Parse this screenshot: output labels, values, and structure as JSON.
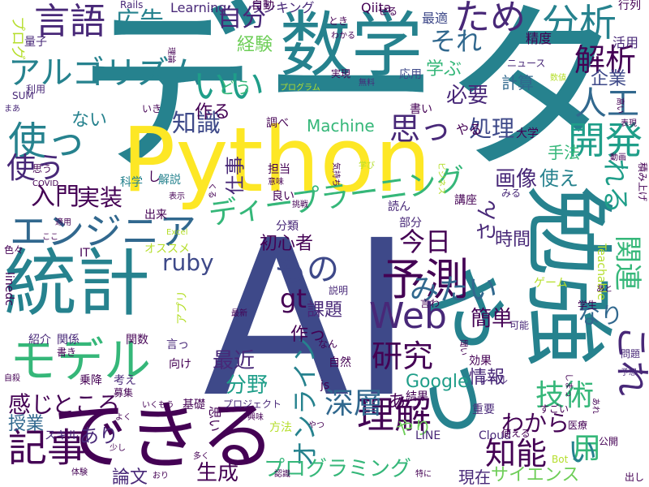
{
  "palette": {
    "yellow": "#fde725",
    "light_green": "#b5de2b",
    "green": "#6ece58",
    "green_teal": "#35b779",
    "teal": "#1f9e89",
    "blue_teal": "#26828e",
    "blue": "#31688e",
    "indigo": "#3e4989",
    "purple": "#482878",
    "dark_purple": "#440154"
  },
  "words": [
    {
      "text": "データ",
      "color": "#26828e",
      "rot": 0
    },
    {
      "text": "AI",
      "color": "#3e4989",
      "rot": 0
    },
    {
      "text": "Python",
      "color": "#fde725",
      "rot": 0
    },
    {
      "text": "数学",
      "color": "#26828e",
      "rot": 0
    },
    {
      "text": "勉強",
      "color": "#26828e",
      "rot": 90
    },
    {
      "text": "できる",
      "color": "#440154",
      "rot": 0
    },
    {
      "text": "統計",
      "color": "#26828e",
      "rot": 0
    },
    {
      "text": "やっ",
      "color": "#26828e",
      "rot": 90
    },
    {
      "text": "モデル",
      "color": "#35b779",
      "rot": 0
    },
    {
      "text": "言語",
      "color": "#482878",
      "rot": 0
    },
    {
      "text": "アルゴリズム",
      "color": "#26828e",
      "rot": 0
    },
    {
      "text": "使っ",
      "color": "#26828e",
      "rot": 0
    },
    {
      "text": "エンジニア",
      "color": "#31688e",
      "rot": 0
    },
    {
      "text": "ディープラーニング",
      "color": "#35b779",
      "rot": 0
    },
    {
      "text": "予測",
      "color": "#440154",
      "rot": 0
    },
    {
      "text": "分析",
      "color": "#26828e",
      "rot": 0
    },
    {
      "text": "ため",
      "color": "#482878",
      "rot": 0
    },
    {
      "text": "開発",
      "color": "#1f9e89",
      "rot": 0
    },
    {
      "text": "人工",
      "color": "#31688e",
      "rot": 0
    },
    {
      "text": "解析",
      "color": "#440154",
      "rot": 0
    },
    {
      "text": "自分",
      "color": "#482878",
      "rot": 0
    },
    {
      "text": "いい",
      "color": "#1f9e89",
      "rot": 0
    },
    {
      "text": "Web",
      "color": "#482878",
      "rot": 0
    },
    {
      "text": "理解",
      "color": "#440154",
      "rot": 0
    },
    {
      "text": "記事",
      "color": "#440154",
      "rot": 0
    },
    {
      "text": "研究",
      "color": "#440154",
      "rot": 0
    },
    {
      "text": "技術",
      "color": "#35b779",
      "rot": 0
    },
    {
      "text": "知能",
      "color": "#440154",
      "rot": 0
    },
    {
      "text": "深層",
      "color": "#31688e",
      "rot": 0
    },
    {
      "text": "もの",
      "color": "#3e4989",
      "rot": 0
    },
    {
      "text": "入門",
      "color": "#440154",
      "rot": 0
    },
    {
      "text": "これ",
      "color": "#482878",
      "rot": 90
    },
    {
      "text": "使う",
      "color": "#482878",
      "rot": 0
    },
    {
      "text": "オンライン",
      "color": "#26828e",
      "rot": 270
    },
    {
      "text": "プログラミング",
      "color": "#35b779",
      "rot": 0
    },
    {
      "text": "みたい",
      "color": "#31688e",
      "rot": 0
    },
    {
      "text": "今日",
      "color": "#440154",
      "rot": 0
    },
    {
      "text": "知識",
      "color": "#3e4989",
      "rot": 0
    },
    {
      "text": "関連",
      "color": "#35b779",
      "rot": 90
    },
    {
      "text": "用",
      "color": "#35b779",
      "rot": 0
    },
    {
      "text": "思っ",
      "color": "#482878",
      "rot": 0
    },
    {
      "text": "それ",
      "color": "#31688e",
      "rot": 0
    },
    {
      "text": "企業",
      "color": "#3e4989",
      "rot": 0
    },
    {
      "text": "ruby",
      "color": "#3e4989",
      "rot": 0
    },
    {
      "text": "gt",
      "color": "#440154",
      "rot": 0
    },
    {
      "text": "初心者",
      "color": "#440154",
      "rot": 0
    },
    {
      "text": "広告",
      "color": "#26828e",
      "rot": 0
    },
    {
      "text": "処理",
      "color": "#3e4989",
      "rot": 0
    },
    {
      "text": "画像",
      "color": "#482878",
      "rot": 0
    },
    {
      "text": "使え",
      "color": "#26828e",
      "rot": 0
    },
    {
      "text": "実装",
      "color": "#440154",
      "rot": 0
    },
    {
      "text": "仕事",
      "color": "#482878",
      "rot": 270
    },
    {
      "text": "Machine",
      "color": "#35b779",
      "rot": 0
    },
    {
      "text": "簡単",
      "color": "#440154",
      "rot": 0
    },
    {
      "text": "最近",
      "color": "#482878",
      "rot": 0
    },
    {
      "text": "分野",
      "color": "#1f9e89",
      "rot": 0
    },
    {
      "text": "感じ",
      "color": "#440154",
      "rot": 0
    },
    {
      "text": "ところ",
      "color": "#440154",
      "rot": 0
    },
    {
      "text": "わから",
      "color": "#440154",
      "rot": 0
    },
    {
      "text": "あり",
      "color": "#482878",
      "rot": 0
    },
    {
      "text": "授業",
      "color": "#31688e",
      "rot": 0
    },
    {
      "text": "論文",
      "color": "#482878",
      "rot": 0
    },
    {
      "text": "生成",
      "color": "#440154",
      "rot": 0
    },
    {
      "text": "Google",
      "color": "#1f9e89",
      "rot": 0
    },
    {
      "text": "情報",
      "color": "#482878",
      "rot": 0
    },
    {
      "text": "あっ",
      "color": "#440154",
      "rot": 0
    },
    {
      "text": "課題",
      "color": "#482878",
      "rot": 0
    },
    {
      "text": "作っ",
      "color": "#440154",
      "rot": 0
    },
    {
      "text": "時間",
      "color": "#482878",
      "rot": 0
    },
    {
      "text": "さん",
      "color": "#482878",
      "rot": 270
    },
    {
      "text": "れる",
      "color": "#1f9e89",
      "rot": 90
    },
    {
      "text": "経験",
      "color": "#6ece58",
      "rot": 0
    },
    {
      "text": "作る",
      "color": "#440154",
      "rot": 0
    },
    {
      "text": "必要",
      "color": "#482878",
      "rot": 0
    },
    {
      "text": "学ぶ",
      "color": "#35b779",
      "rot": 0
    },
    {
      "text": "計算",
      "color": "#31688e",
      "rot": 0
    },
    {
      "text": "手法",
      "color": "#35b779",
      "rot": 0
    },
    {
      "text": "なり",
      "color": "#31688e",
      "rot": 0
    },
    {
      "text": "い",
      "color": "#26828e",
      "rot": 0
    },
    {
      "text": "サイエンス",
      "color": "#6ece58",
      "rot": 0
    },
    {
      "text": "現在",
      "color": "#482878",
      "rot": 0
    },
    {
      "text": "やり",
      "color": "#6ece58",
      "rot": 0
    },
    {
      "text": "ランキング",
      "color": "#482878",
      "rot": 0
    },
    {
      "text": "ない",
      "color": "#26828e",
      "rot": 0
    },
    {
      "text": "どう",
      "color": "#35b779",
      "rot": 0
    },
    {
      "text": "自動",
      "color": "#440154",
      "rot": 0
    },
    {
      "text": "Qiita",
      "color": "#440154",
      "rot": 0
    },
    {
      "text": "ニュース",
      "color": "#482878",
      "rot": 0
    },
    {
      "text": "最適",
      "color": "#3e4989",
      "rot": 0
    },
    {
      "text": "精度",
      "color": "#440154",
      "rot": 0
    },
    {
      "text": "活用",
      "color": "#482878",
      "rot": 0
    },
    {
      "text": "行列",
      "color": "#440154",
      "rot": 0
    },
    {
      "text": "大学",
      "color": "#440154",
      "rot": 0
    },
    {
      "text": "Learning",
      "color": "#482878",
      "rot": 0
    },
    {
      "text": "Rails",
      "color": "#482878",
      "rot": 0
    },
    {
      "text": "量子",
      "color": "#482878",
      "rot": 0
    },
    {
      "text": "プログ",
      "color": "#b5de2b",
      "rot": 90
    },
    {
      "text": "SUM",
      "color": "#482878",
      "rot": 0
    },
    {
      "text": "利用",
      "color": "#482878",
      "rot": 0
    },
    {
      "text": "まあ",
      "color": "#482878",
      "rot": 0
    },
    {
      "text": "科学",
      "color": "#26828e",
      "rot": 0
    },
    {
      "text": "解説",
      "color": "#26828e",
      "rot": 0
    },
    {
      "text": "担当",
      "color": "#440154",
      "rot": 0
    },
    {
      "text": "良い",
      "color": "#440154",
      "rot": 0
    },
    {
      "text": "挑戦",
      "color": "#440154",
      "rot": 0
    },
    {
      "text": "読ん",
      "color": "#482878",
      "rot": 0
    },
    {
      "text": "講座",
      "color": "#440154",
      "rot": 0
    },
    {
      "text": "部分",
      "color": "#482878",
      "rot": 0
    },
    {
      "text": "分類",
      "color": "#482878",
      "rot": 0
    },
    {
      "text": "みる",
      "color": "#482878",
      "rot": 0
    },
    {
      "text": "積み上げ",
      "color": "#440154",
      "rot": 90
    },
    {
      "text": "出来",
      "color": "#440154",
      "rot": 0
    },
    {
      "text": "オススメ",
      "color": "#b5de2b",
      "rot": 0
    },
    {
      "text": "IT",
      "color": "#440154",
      "rot": 0
    },
    {
      "text": "Excel",
      "color": "#b5de2b",
      "rot": 0
    },
    {
      "text": "色々",
      "color": "#440154",
      "rot": 0
    },
    {
      "text": "COVID",
      "color": "#440154",
      "rot": 0
    },
    {
      "text": "linedc",
      "color": "#440154",
      "rot": 90
    },
    {
      "text": "アプリ",
      "color": "#b5de2b",
      "rot": 270
    },
    {
      "text": "紹介",
      "color": "#482878",
      "rot": 0
    },
    {
      "text": "関係",
      "color": "#482878",
      "rot": 0
    },
    {
      "text": "関数",
      "color": "#440154",
      "rot": 0
    },
    {
      "text": "言っ",
      "color": "#482878",
      "rot": 0
    },
    {
      "text": "向け",
      "color": "#440154",
      "rot": 0
    },
    {
      "text": "書き",
      "color": "#440154",
      "rot": 0
    },
    {
      "text": "乗降",
      "color": "#440154",
      "rot": 0
    },
    {
      "text": "考え",
      "color": "#482878",
      "rot": 0
    },
    {
      "text": "募集",
      "color": "#440154",
      "rot": 0
    },
    {
      "text": "スキル",
      "color": "#482878",
      "rot": 0
    },
    {
      "text": "基礎",
      "color": "#440154",
      "rot": 0
    },
    {
      "text": "プロジェクト",
      "color": "#482878",
      "rot": 0
    },
    {
      "text": "方法",
      "color": "#b5de2b",
      "rot": 0
    },
    {
      "text": "結果",
      "color": "#440154",
      "rot": 0
    },
    {
      "text": "効果",
      "color": "#440154",
      "rot": 0
    },
    {
      "text": "重要",
      "color": "#482878",
      "rot": 0
    },
    {
      "text": "自然",
      "color": "#440154",
      "rot": 0
    },
    {
      "text": "js",
      "color": "#440154",
      "rot": 0
    },
    {
      "text": "LINE",
      "color": "#482878",
      "rot": 0
    },
    {
      "text": "Cloud",
      "color": "#482878",
      "rot": 0
    },
    {
      "text": "使える",
      "color": "#440154",
      "rot": 0
    },
    {
      "text": "すごい",
      "color": "#440154",
      "rot": 0
    },
    {
      "text": "医療",
      "color": "#440154",
      "rot": 0
    },
    {
      "text": "公開",
      "color": "#440154",
      "rot": 0
    },
    {
      "text": "Bot",
      "color": "#b5de2b",
      "rot": 0
    },
    {
      "text": "ゲーム",
      "color": "#b5de2b",
      "rot": 0
    },
    {
      "text": "可能",
      "color": "#482878",
      "rot": 0
    },
    {
      "text": "レベル",
      "color": "#482878",
      "rot": 0
    },
    {
      "text": "問題",
      "color": "#482878",
      "rot": 0
    },
    {
      "text": "予想",
      "color": "#482878",
      "rot": 0
    },
    {
      "text": "学生",
      "color": "#440154",
      "rot": 0
    },
    {
      "text": "Teachable",
      "color": "#b5de2b",
      "rot": 90
    },
    {
      "text": "説明",
      "color": "#482878",
      "rot": 0
    },
    {
      "text": "最新",
      "color": "#440154",
      "rot": 0
    },
    {
      "text": "言わ",
      "color": "#440154",
      "rot": 0
    },
    {
      "text": "あと",
      "color": "#440154",
      "rot": 0
    },
    {
      "text": "書い",
      "color": "#440154",
      "rot": 0
    },
    {
      "text": "応用",
      "color": "#3e4989",
      "rot": 0
    },
    {
      "text": "無料",
      "color": "#482878",
      "rot": 0
    },
    {
      "text": "実現",
      "color": "#440154",
      "rot": 0
    },
    {
      "text": "プログラム",
      "color": "#b5de2b",
      "rot": 0
    },
    {
      "text": "調べ",
      "color": "#440154",
      "rot": 0
    },
    {
      "text": "表示",
      "color": "#440154",
      "rot": 0
    },
    {
      "text": "意味",
      "color": "#440154",
      "rot": 0
    },
    {
      "text": "気持ち",
      "color": "#440154",
      "rot": 90
    },
    {
      "text": "ビジネス",
      "color": "#b5de2b",
      "rot": 90
    },
    {
      "text": "動画",
      "color": "#440154",
      "rot": 0
    },
    {
      "text": "数値",
      "color": "#b5de2b",
      "rot": 0
    },
    {
      "text": "高い",
      "color": "#440154",
      "rot": 90
    },
    {
      "text": "表現",
      "color": "#440154",
      "rot": 0
    },
    {
      "text": "せる",
      "color": "#440154",
      "rot": 0
    },
    {
      "text": "とき",
      "color": "#440154",
      "rot": 0
    },
    {
      "text": "わかる",
      "color": "#440154",
      "rot": 0
    },
    {
      "text": "いき",
      "color": "#440154",
      "rot": 0
    },
    {
      "text": "思う",
      "color": "#440154",
      "rot": 0
    },
    {
      "text": "学び",
      "color": "#b5de2b",
      "rot": 0
    },
    {
      "text": "適用",
      "color": "#440154",
      "rot": 0
    },
    {
      "text": "ここ",
      "color": "#440154",
      "rot": 0
    },
    {
      "text": "なん",
      "color": "#440154",
      "rot": 0
    },
    {
      "text": "よく",
      "color": "#440154",
      "rot": 0
    },
    {
      "text": "いくもう",
      "color": "#440154",
      "rot": 0
    },
    {
      "text": "少し",
      "color": "#440154",
      "rot": 0
    },
    {
      "text": "興味",
      "color": "#440154",
      "rot": 0
    },
    {
      "text": "体験",
      "color": "#440154",
      "rot": 0
    },
    {
      "text": "おり",
      "color": "#440154",
      "rot": 0
    },
    {
      "text": "多く",
      "color": "#440154",
      "rot": 0
    },
    {
      "text": "認識",
      "color": "#440154",
      "rot": 0
    },
    {
      "text": "特に",
      "color": "#440154",
      "rot": 0
    },
    {
      "text": "出し",
      "color": "#440154",
      "rot": 0
    },
    {
      "text": "自殺",
      "color": "#440154",
      "rot": 0
    },
    {
      "text": "聞い",
      "color": "#440154",
      "rot": 90
    },
    {
      "text": "やつ",
      "color": "#440154",
      "rot": 0
    },
    {
      "text": "あれ",
      "color": "#440154",
      "rot": 90
    },
    {
      "text": "しまっ",
      "color": "#440154",
      "rot": 90
    },
    {
      "text": "理論",
      "color": "#440154",
      "rot": 90
    },
    {
      "text": "くる",
      "color": "#440154",
      "rot": 90
    },
    {
      "text": "やる",
      "color": "#440154",
      "rot": 0
    },
    {
      "text": "思い",
      "color": "#440154",
      "rot": 90
    },
    {
      "text": "し",
      "color": "#440154",
      "rot": 0
    }
  ]
}
